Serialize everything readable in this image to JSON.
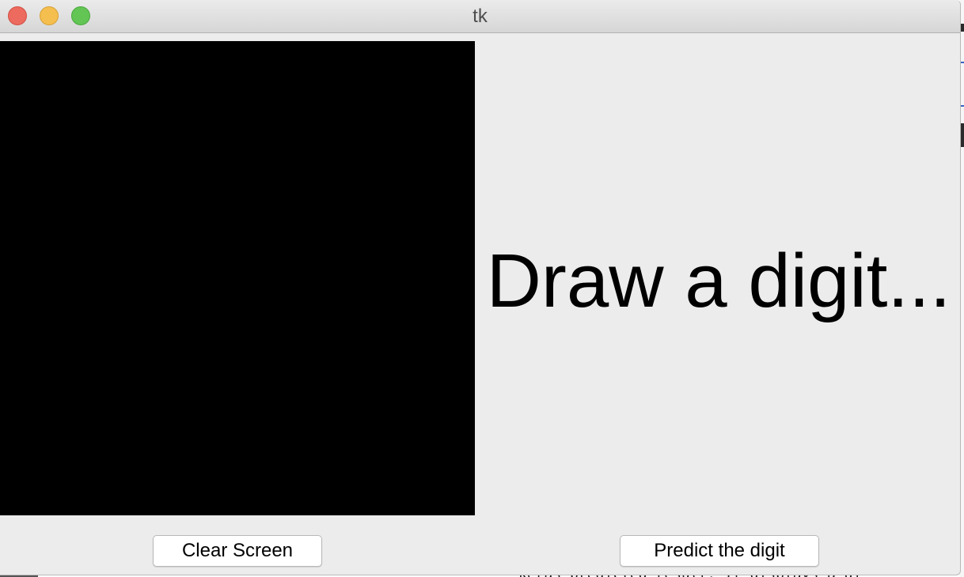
{
  "window": {
    "title": "tk"
  },
  "canvas": {
    "background_color": "#000000"
  },
  "main": {
    "prompt_text": "Draw a digit..."
  },
  "buttons": {
    "clear_label": "Clear Screen",
    "predict_label": "Predict the digit"
  },
  "background": {
    "partial_text": "keras predicted result. It displays a di"
  },
  "colors": {
    "close": "#ed6a5e",
    "minimize": "#f5bf4f",
    "maximize": "#62c554",
    "window_bg": "#ececec"
  }
}
